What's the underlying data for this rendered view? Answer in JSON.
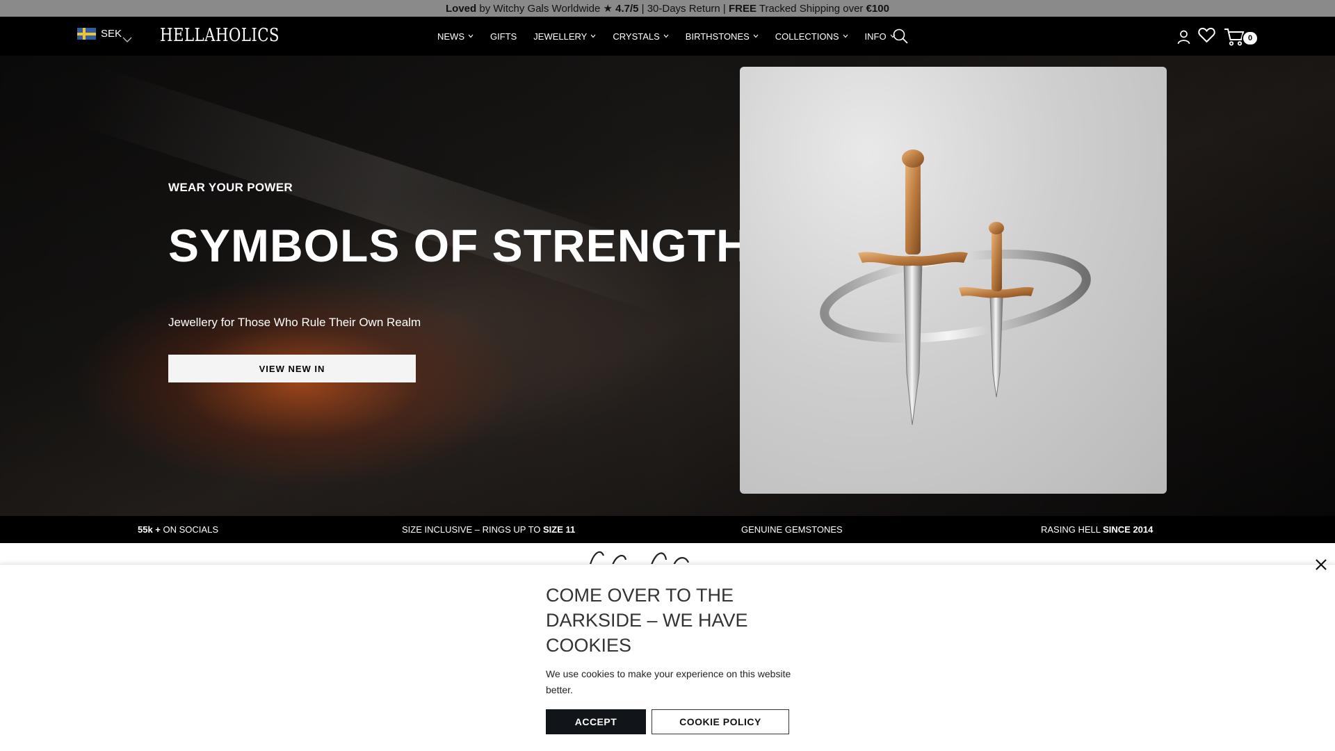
{
  "announcement": {
    "loved": "Loved",
    "by_text": " by Witchy Gals Worldwide ",
    "star": "★",
    "rating": " 4.7/5",
    "sep1": " | 30-Days Return | ",
    "free": "FREE",
    "shipping": " Tracked Shipping over ",
    "threshold": "€100"
  },
  "header": {
    "currency": "SEK",
    "logo": "HELLAHOLICS",
    "nav": [
      {
        "label": "NEWS",
        "has_dropdown": true
      },
      {
        "label": "GIFTS",
        "has_dropdown": false
      },
      {
        "label": "JEWELLERY",
        "has_dropdown": true
      },
      {
        "label": "CRYSTALS",
        "has_dropdown": true
      },
      {
        "label": "BIRTHSTONES",
        "has_dropdown": true
      },
      {
        "label": "COLLECTIONS",
        "has_dropdown": true
      },
      {
        "label": "INFO",
        "has_dropdown": true
      }
    ],
    "cart_count": "0",
    "icons": [
      "search-icon",
      "account-icon",
      "wishlist-icon",
      "cart-icon"
    ]
  },
  "hero": {
    "eyebrow": "WEAR YOUR POWER",
    "title": "SYMBOLS OF STRENGTH",
    "subtitle": "Jewellery for Those Who Rule Their Own Realm",
    "cta": "VIEW NEW IN"
  },
  "usp": {
    "socials_bold": "55k +",
    "socials_rest": " ON SOCIALS",
    "size_rest": "SIZE INCLUSIVE – RINGS UP TO ",
    "size_bold": "SIZE 11",
    "gemstones": "GENUINE GEMSTONES",
    "hell_rest": "RASING HELL ",
    "hell_bold": "SINCE 2014"
  },
  "cookie": {
    "title": "COME OVER TO THE DARKSIDE – WE HAVE COOKIES",
    "text": "We use cookies to make your experience on this website better.",
    "accept": "ACCEPT",
    "policy": "COOKIE POLICY"
  },
  "colors": {
    "header_bg": "#000000",
    "announcement_bg": "#8a8a8a",
    "accept_bg": "#111418"
  }
}
